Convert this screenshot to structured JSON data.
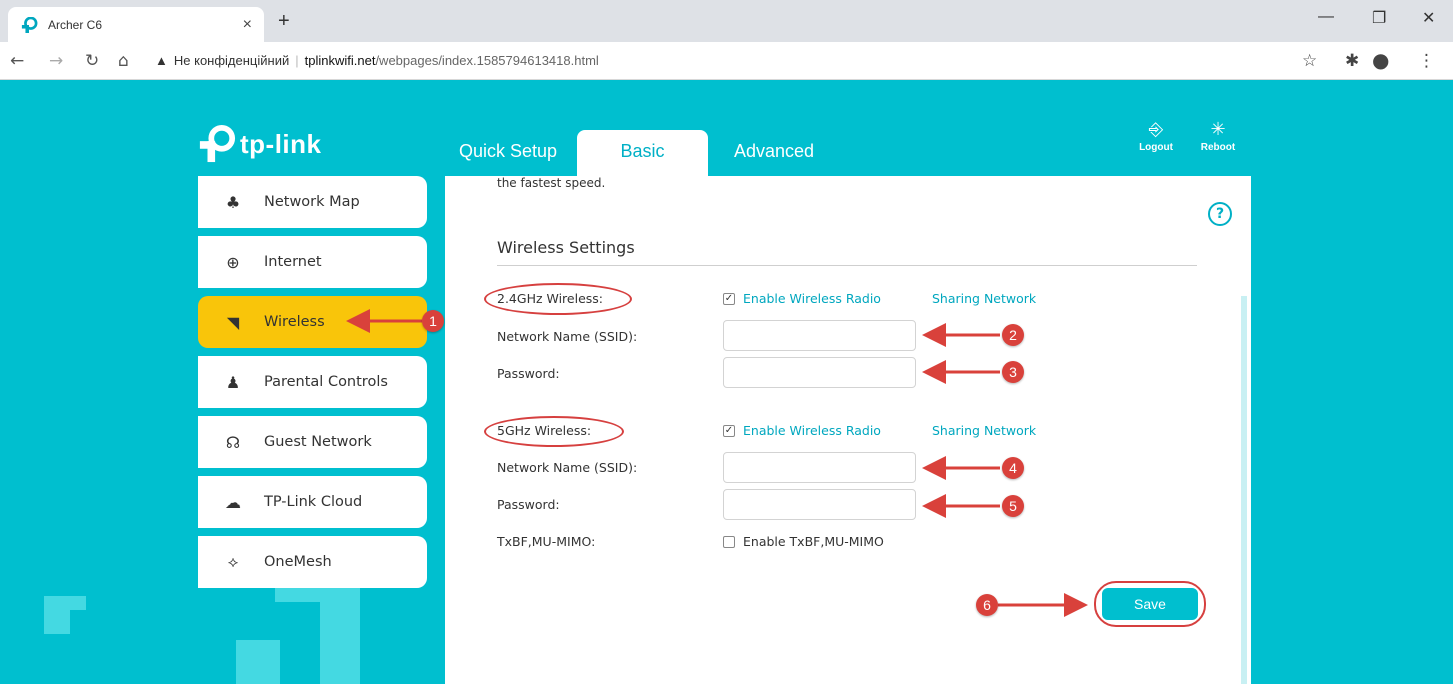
{
  "browser": {
    "tab_title": "Archer C6",
    "close_glyph": "×",
    "new_tab_glyph": "+",
    "address_warning": "Не конфіденційний",
    "address_host": "tplinkwifi.net",
    "address_path": "/webpages/index.1585794613418.html"
  },
  "brand": {
    "name": "tp-link"
  },
  "top_nav": {
    "tabs": [
      {
        "label": "Quick Setup"
      },
      {
        "label": "Basic"
      },
      {
        "label": "Advanced"
      }
    ],
    "logout_label": "Logout",
    "reboot_label": "Reboot"
  },
  "sidebar": {
    "items": [
      {
        "label": "Network Map",
        "icon": "network-map-icon"
      },
      {
        "label": "Internet",
        "icon": "globe-icon"
      },
      {
        "label": "Wireless",
        "icon": "wifi-icon"
      },
      {
        "label": "Parental Controls",
        "icon": "family-icon"
      },
      {
        "label": "Guest Network",
        "icon": "guest-icon"
      },
      {
        "label": "TP-Link Cloud",
        "icon": "cloud-icon"
      },
      {
        "label": "OneMesh",
        "icon": "onemesh-icon"
      }
    ]
  },
  "content": {
    "intro_text": "the fastest speed.",
    "section_title": "Wireless Settings",
    "band24": {
      "label": "2.4GHz Wireless:",
      "enable_label": "Enable Wireless Radio",
      "enabled": true,
      "sharing_label": "Sharing Network",
      "ssid_label": "Network Name (SSID):",
      "ssid_value": "",
      "password_label": "Password:",
      "password_value": ""
    },
    "band5": {
      "label": "5GHz Wireless:",
      "enable_label": "Enable Wireless Radio",
      "enabled": true,
      "sharing_label": "Sharing Network",
      "ssid_label": "Network Name (SSID):",
      "ssid_value": "",
      "password_label": "Password:",
      "password_value": ""
    },
    "txbf": {
      "label": "TxBF,MU-MIMO:",
      "enable_label": "Enable TxBF,MU-MIMO",
      "enabled": false
    },
    "save_label": "Save"
  },
  "annotations": {
    "badges": [
      "1",
      "2",
      "3",
      "4",
      "5",
      "6"
    ],
    "color": "#d9413b"
  }
}
